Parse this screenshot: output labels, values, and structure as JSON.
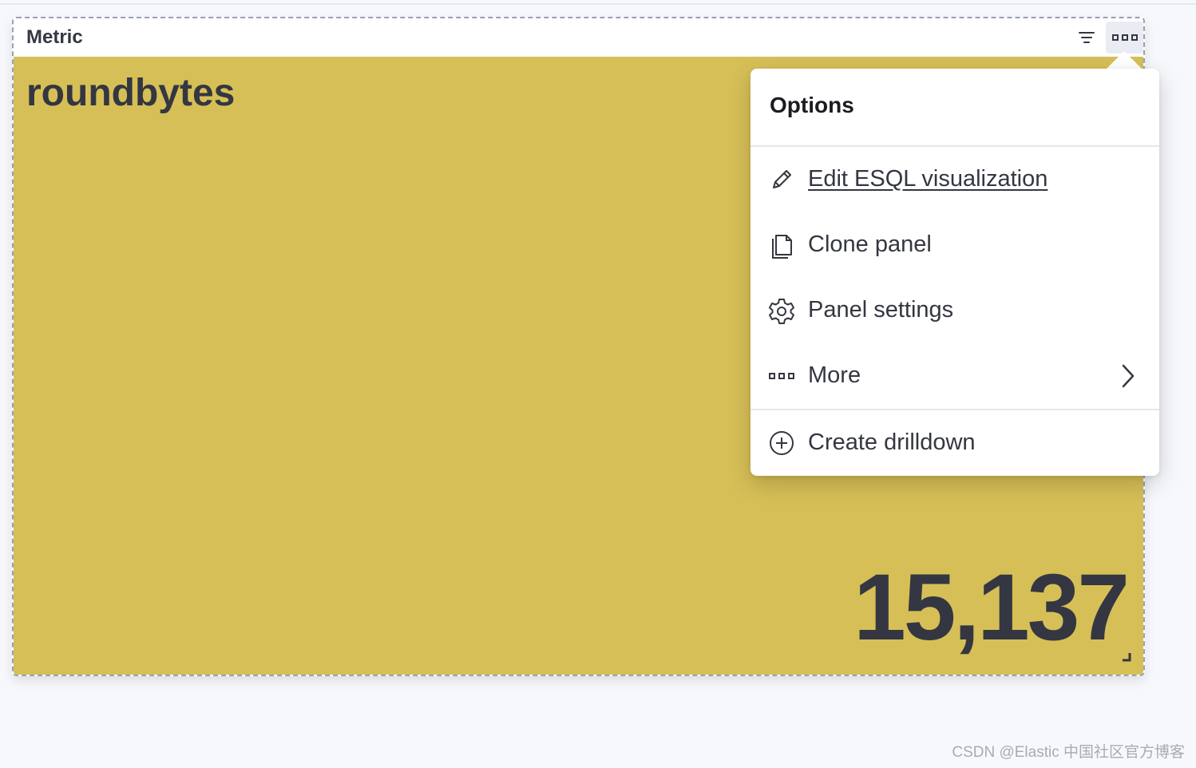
{
  "panel": {
    "title": "Metric",
    "filter_icon": "filter-icon",
    "options_icon": "ellipsis-icon"
  },
  "metric": {
    "label": "roundbytes",
    "value": "15,137",
    "background_color": "#d6bf57",
    "text_color": "#343741"
  },
  "options_menu": {
    "title": "Options",
    "items": [
      {
        "label": "Edit ESQL visualization",
        "icon": "pencil-icon"
      },
      {
        "label": "Clone panel",
        "icon": "copy-icon"
      },
      {
        "label": "Panel settings",
        "icon": "gear-icon"
      },
      {
        "label": "More",
        "icon": "ellipsis-icon",
        "submenu": true
      },
      {
        "label": "Create drilldown",
        "icon": "plus-circle-icon"
      }
    ]
  },
  "watermark": "CSDN @Elastic 中国社区官方博客"
}
